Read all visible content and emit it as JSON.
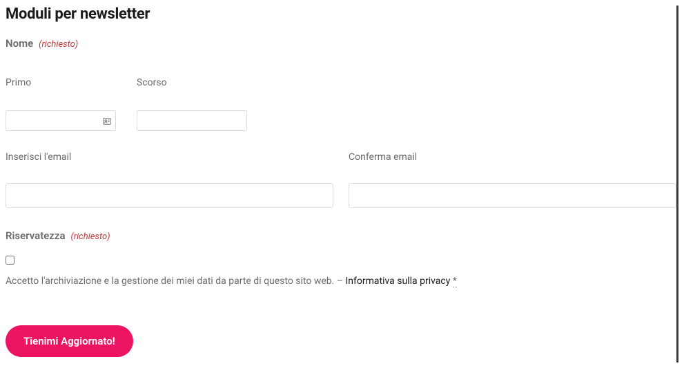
{
  "form": {
    "heading": "Moduli per newsletter",
    "name": {
      "label": "Nome",
      "required_text": "(richiesto)",
      "first_label": "Primo",
      "last_label": "Scorso",
      "first_value": "",
      "last_value": ""
    },
    "email": {
      "enter_label": "Inserisci l'email",
      "confirm_label": "Conferma email",
      "enter_value": "",
      "confirm_value": ""
    },
    "privacy": {
      "label": "Riservatezza",
      "required_text": "(richiesto)",
      "consent_text": "Accetto l'archiviazione e la gestione dei miei dati da parte di questo sito web. ",
      "link_text": "Informativa sulla privacy",
      "asterisk": "*",
      "dash": "– "
    },
    "submit": {
      "label": "Tienimi Aggiornato!"
    }
  }
}
